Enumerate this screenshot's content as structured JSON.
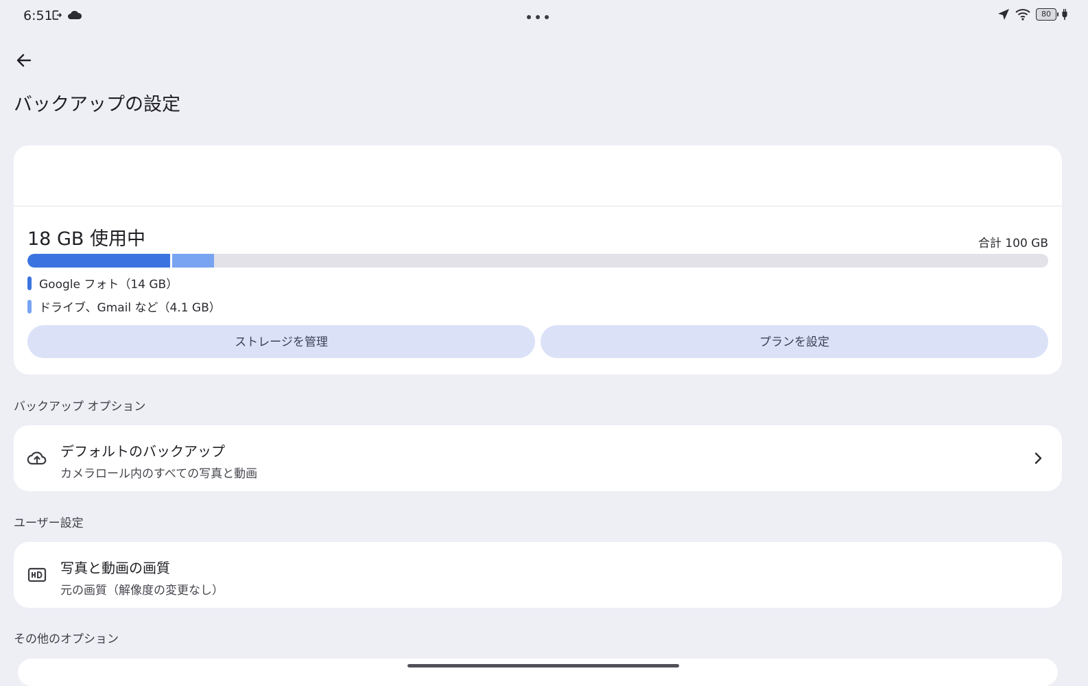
{
  "status_bar": {
    "time": "6:51",
    "battery": "80",
    "icons": [
      "screen-record-icon",
      "cloud-icon",
      "location-arrow-icon",
      "wifi-icon",
      "battery-icon",
      "charging-icon"
    ]
  },
  "header": {
    "title": "バックアップの設定"
  },
  "storage": {
    "used_label": "18 GB 使用中",
    "total_label": "合計 100 GB",
    "segments": [
      {
        "label": "Google フォト（14 GB）",
        "gb": 14,
        "color": "#3b74e0"
      },
      {
        "label": "ドライブ、Gmail など（4.1 GB）",
        "gb": 4.1,
        "color": "#78a4f2"
      }
    ],
    "total_gb": 100,
    "manage_button": "ストレージを管理",
    "plan_button": "プランを設定"
  },
  "sections": {
    "backup_options": "バックアップ オプション",
    "user_settings": "ユーザー設定",
    "other_options": "その他のオプション"
  },
  "backup_item": {
    "title": "デフォルトのバックアップ",
    "subtitle": "カメラロール内のすべての写真と動画",
    "icon": "cloud-upload-icon"
  },
  "quality_item": {
    "title": "写真と動画の画質",
    "subtitle": "元の画質（解像度の変更なし）",
    "icon": "hd-icon"
  }
}
